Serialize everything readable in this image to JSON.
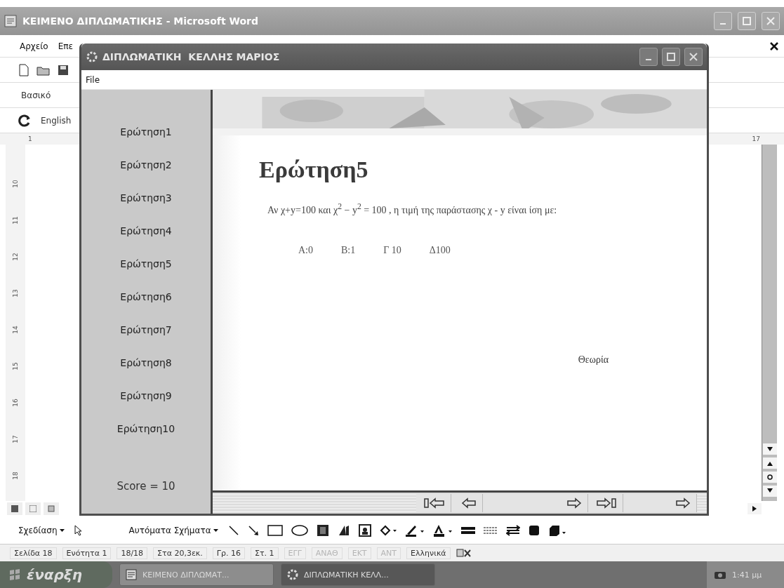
{
  "word_window": {
    "title": "ΚΕΙΜΕΝΟ ΔΙΠΛΩΜΑΤΙΚΗΣ - Microsoft Word",
    "menu": [
      "Αρχείο",
      "Επε"
    ],
    "style_box": "Βασικό",
    "language_box": "English",
    "ruler_numbers": [
      "1",
      "17"
    ],
    "vertical_ruler_numbers": [
      "10",
      "11",
      "12",
      "13",
      "14",
      "15",
      "16",
      "17",
      "18"
    ],
    "drawing_toolbar": {
      "draw_menu": "Σχεδίαση",
      "autoshapes_menu": "Αυτόματα Σχήματα"
    },
    "status_bar": [
      {
        "text": "Σελίδα 18",
        "disabled": false
      },
      {
        "text": "Ενότητα 1",
        "disabled": false
      },
      {
        "text": "18/18",
        "disabled": false
      },
      {
        "text": "Στα 20,3εκ.",
        "disabled": false
      },
      {
        "text": "Γρ. 16",
        "disabled": false
      },
      {
        "text": "Στ. 1",
        "disabled": false
      },
      {
        "text": "ΕΓΓ",
        "disabled": true
      },
      {
        "text": "ΑΝΑΘ",
        "disabled": true
      },
      {
        "text": "ΕΚΤ",
        "disabled": true
      },
      {
        "text": "ΑΝΤ",
        "disabled": true
      },
      {
        "text": "Ελληνικά",
        "disabled": false
      }
    ]
  },
  "app_window": {
    "title": "ΔΙΠΛΩΜΑΤΙΚΗ  ΚΕΛΛΗΣ ΜΑΡΙΟΣ",
    "menu": [
      "File"
    ],
    "questions": [
      "Ερώτηση1",
      "Ερώτηση2",
      "Ερώτηση3",
      "Ερώτηση4",
      "Ερώτηση5",
      "Ερώτηση6",
      "Ερώτηση7",
      "Ερώτηση8",
      "Ερώτηση9",
      "Ερώτηση10"
    ],
    "score": "Score = 10",
    "question": {
      "title": "Ερώτηση5",
      "text": "Αν χ+y=100 και  χ$^{2}$ − y$^{2}$ = 100  , η τιμή της παράστασης  χ - y    είναι ίση με:",
      "answers": [
        "Α:0",
        "Β:1",
        "Γ 10",
        "Δ100"
      ],
      "theory_link": "Θεωρία"
    }
  },
  "taskbar": {
    "start": "έναρξη",
    "tasks": [
      {
        "label": "ΚΕΙΜΕΝΟ ΔΙΠΛΩΜΑΤ...",
        "kind": "word",
        "selected": false
      },
      {
        "label": "ΔΙΠΛΩΜΑΤΙΚΗ ΚΕΛΛ...",
        "kind": "app",
        "selected": true
      }
    ],
    "clock": "1:41 μμ"
  }
}
